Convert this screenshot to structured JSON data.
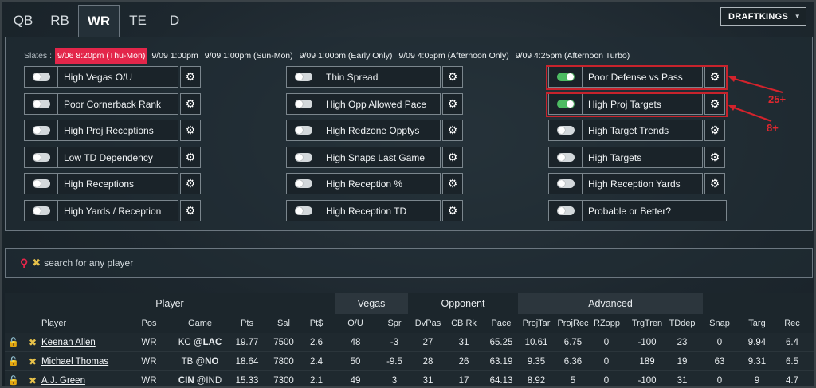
{
  "tabs": [
    "QB",
    "RB",
    "WR",
    "TE",
    "D"
  ],
  "active_tab": "WR",
  "site_select": "DRAFTKINGS",
  "slates": {
    "label": "Slates :",
    "items": [
      "9/06 8:20pm (Thu-Mon)",
      "9/09 1:00pm",
      "9/09 1:00pm (Sun-Mon)",
      "9/09 1:00pm (Early Only)",
      "9/09 4:05pm (Afternoon Only)",
      "9/09 4:25pm (Afternoon Turbo)"
    ]
  },
  "filters": {
    "col1": [
      {
        "label": "High Vegas O/U",
        "on": false
      },
      {
        "label": "Poor Cornerback Rank",
        "on": false
      },
      {
        "label": "High Proj Receptions",
        "on": false
      },
      {
        "label": "Low TD Dependency",
        "on": false
      },
      {
        "label": "High Receptions",
        "on": false
      },
      {
        "label": "High Yards / Reception",
        "on": false
      }
    ],
    "col2": [
      {
        "label": "Thin Spread",
        "on": false
      },
      {
        "label": "High Opp Allowed Pace",
        "on": false
      },
      {
        "label": "High Redzone Opptys",
        "on": false
      },
      {
        "label": "High Snaps Last Game",
        "on": false
      },
      {
        "label": "High Reception %",
        "on": false
      },
      {
        "label": "High Reception TD",
        "on": false
      }
    ],
    "col3": [
      {
        "label": "Poor Defense vs Pass",
        "on": true
      },
      {
        "label": "High Proj Targets",
        "on": true
      },
      {
        "label": "High Target Trends",
        "on": false
      },
      {
        "label": "High Targets",
        "on": false
      },
      {
        "label": "High Reception Yards",
        "on": false
      },
      {
        "label": "Probable or Better?",
        "on": false
      }
    ]
  },
  "annotations": [
    "25+",
    "8+"
  ],
  "search": {
    "placeholder": "search for any player"
  },
  "table": {
    "groups": [
      "Player",
      "Vegas",
      "Opponent",
      "Advanced"
    ],
    "columns": [
      "Player",
      "Pos",
      "Game",
      "Pts",
      "Sal",
      "Pt$",
      "O/U",
      "Spr",
      "DvPas",
      "CB Rk",
      "Pace",
      "ProjTar",
      "ProjRec",
      "RZopp",
      "TrgTren",
      "TDdep",
      "Snap",
      "Targ",
      "Rec"
    ],
    "rows": [
      {
        "name": "Keenan Allen",
        "pos": "WR",
        "game_team": "KC @",
        "game_opp": "LAC",
        "pts": "19.77",
        "sal": "7500",
        "ptd": "2.6",
        "ou": "48",
        "spr": "-3",
        "dvpas": "27",
        "cbrk": "31",
        "pace": "65.25",
        "projtar": "10.61",
        "projrec": "6.75",
        "rzopp": "0",
        "trgtren": "-100",
        "tddep": "23",
        "snap": "0",
        "targ": "9.94",
        "rec": "6.4"
      },
      {
        "name": "Michael Thomas",
        "pos": "WR",
        "game_team": "TB @",
        "game_opp": "NO",
        "pts": "18.64",
        "sal": "7800",
        "ptd": "2.4",
        "ou": "50",
        "spr": "-9.5",
        "dvpas": "28",
        "cbrk": "26",
        "pace": "63.19",
        "projtar": "9.35",
        "projrec": "6.36",
        "rzopp": "0",
        "trgtren": "189",
        "tddep": "19",
        "snap": "63",
        "targ": "9.31",
        "rec": "6.5"
      },
      {
        "name": "A.J. Green",
        "pos": "WR",
        "game_team": "CIN",
        "game_opp": "@IND",
        "pts": "15.33",
        "sal": "7300",
        "ptd": "2.1",
        "ou": "49",
        "spr": "3",
        "dvpas": "31",
        "cbrk": "17",
        "pace": "64.13",
        "projtar": "8.92",
        "projrec": "5",
        "rzopp": "0",
        "trgtren": "-100",
        "tddep": "31",
        "snap": "0",
        "targ": "9",
        "rec": "4.7"
      }
    ]
  },
  "colors": {
    "accent": "#e3264a",
    "toggle_on": "#4dbb62",
    "highlight": "#c8232c",
    "remove": "#e6c14a"
  }
}
